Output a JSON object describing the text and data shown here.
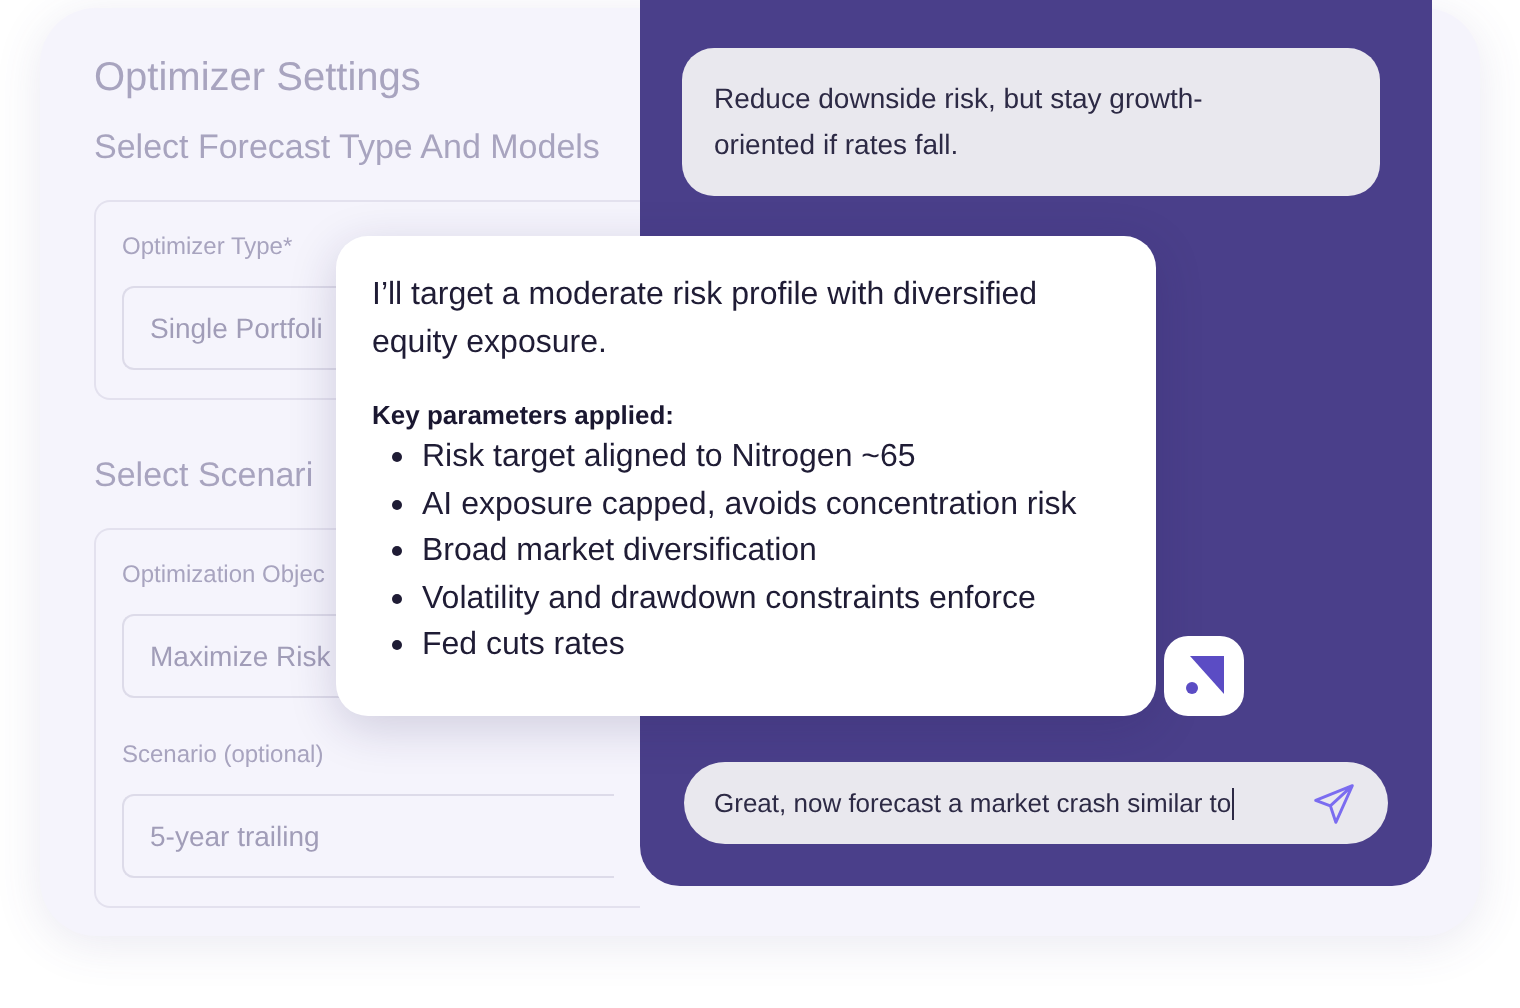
{
  "settings": {
    "title": "Optimizer Settings",
    "sections": [
      {
        "heading": "Select Forecast Type And Models",
        "fields": [
          {
            "label": "Optimizer Type*",
            "value": "Single Portfoli"
          }
        ]
      },
      {
        "heading": "Select Scenari",
        "fields": [
          {
            "label": "Optimization Objec",
            "value": "Maximize Risk"
          },
          {
            "label": "Scenario (optional)",
            "value": "5-year trailing"
          }
        ]
      }
    ]
  },
  "chat": {
    "user_message": "Reduce downside risk, but stay growth-oriented if rates fall.",
    "assistant_message": {
      "intro": "I’ll target a moderate risk profile with diversified equity exposure.",
      "heading": "Key parameters applied:",
      "bullets": [
        "Risk target aligned to Nitrogen ~65",
        "AI exposure capped, avoids concentration risk",
        "Broad market diversification",
        "Volatility and drawdown constraints enforce",
        "Fed cuts rates"
      ]
    },
    "input": {
      "value": "Great, now forecast a market crash similar to"
    }
  }
}
